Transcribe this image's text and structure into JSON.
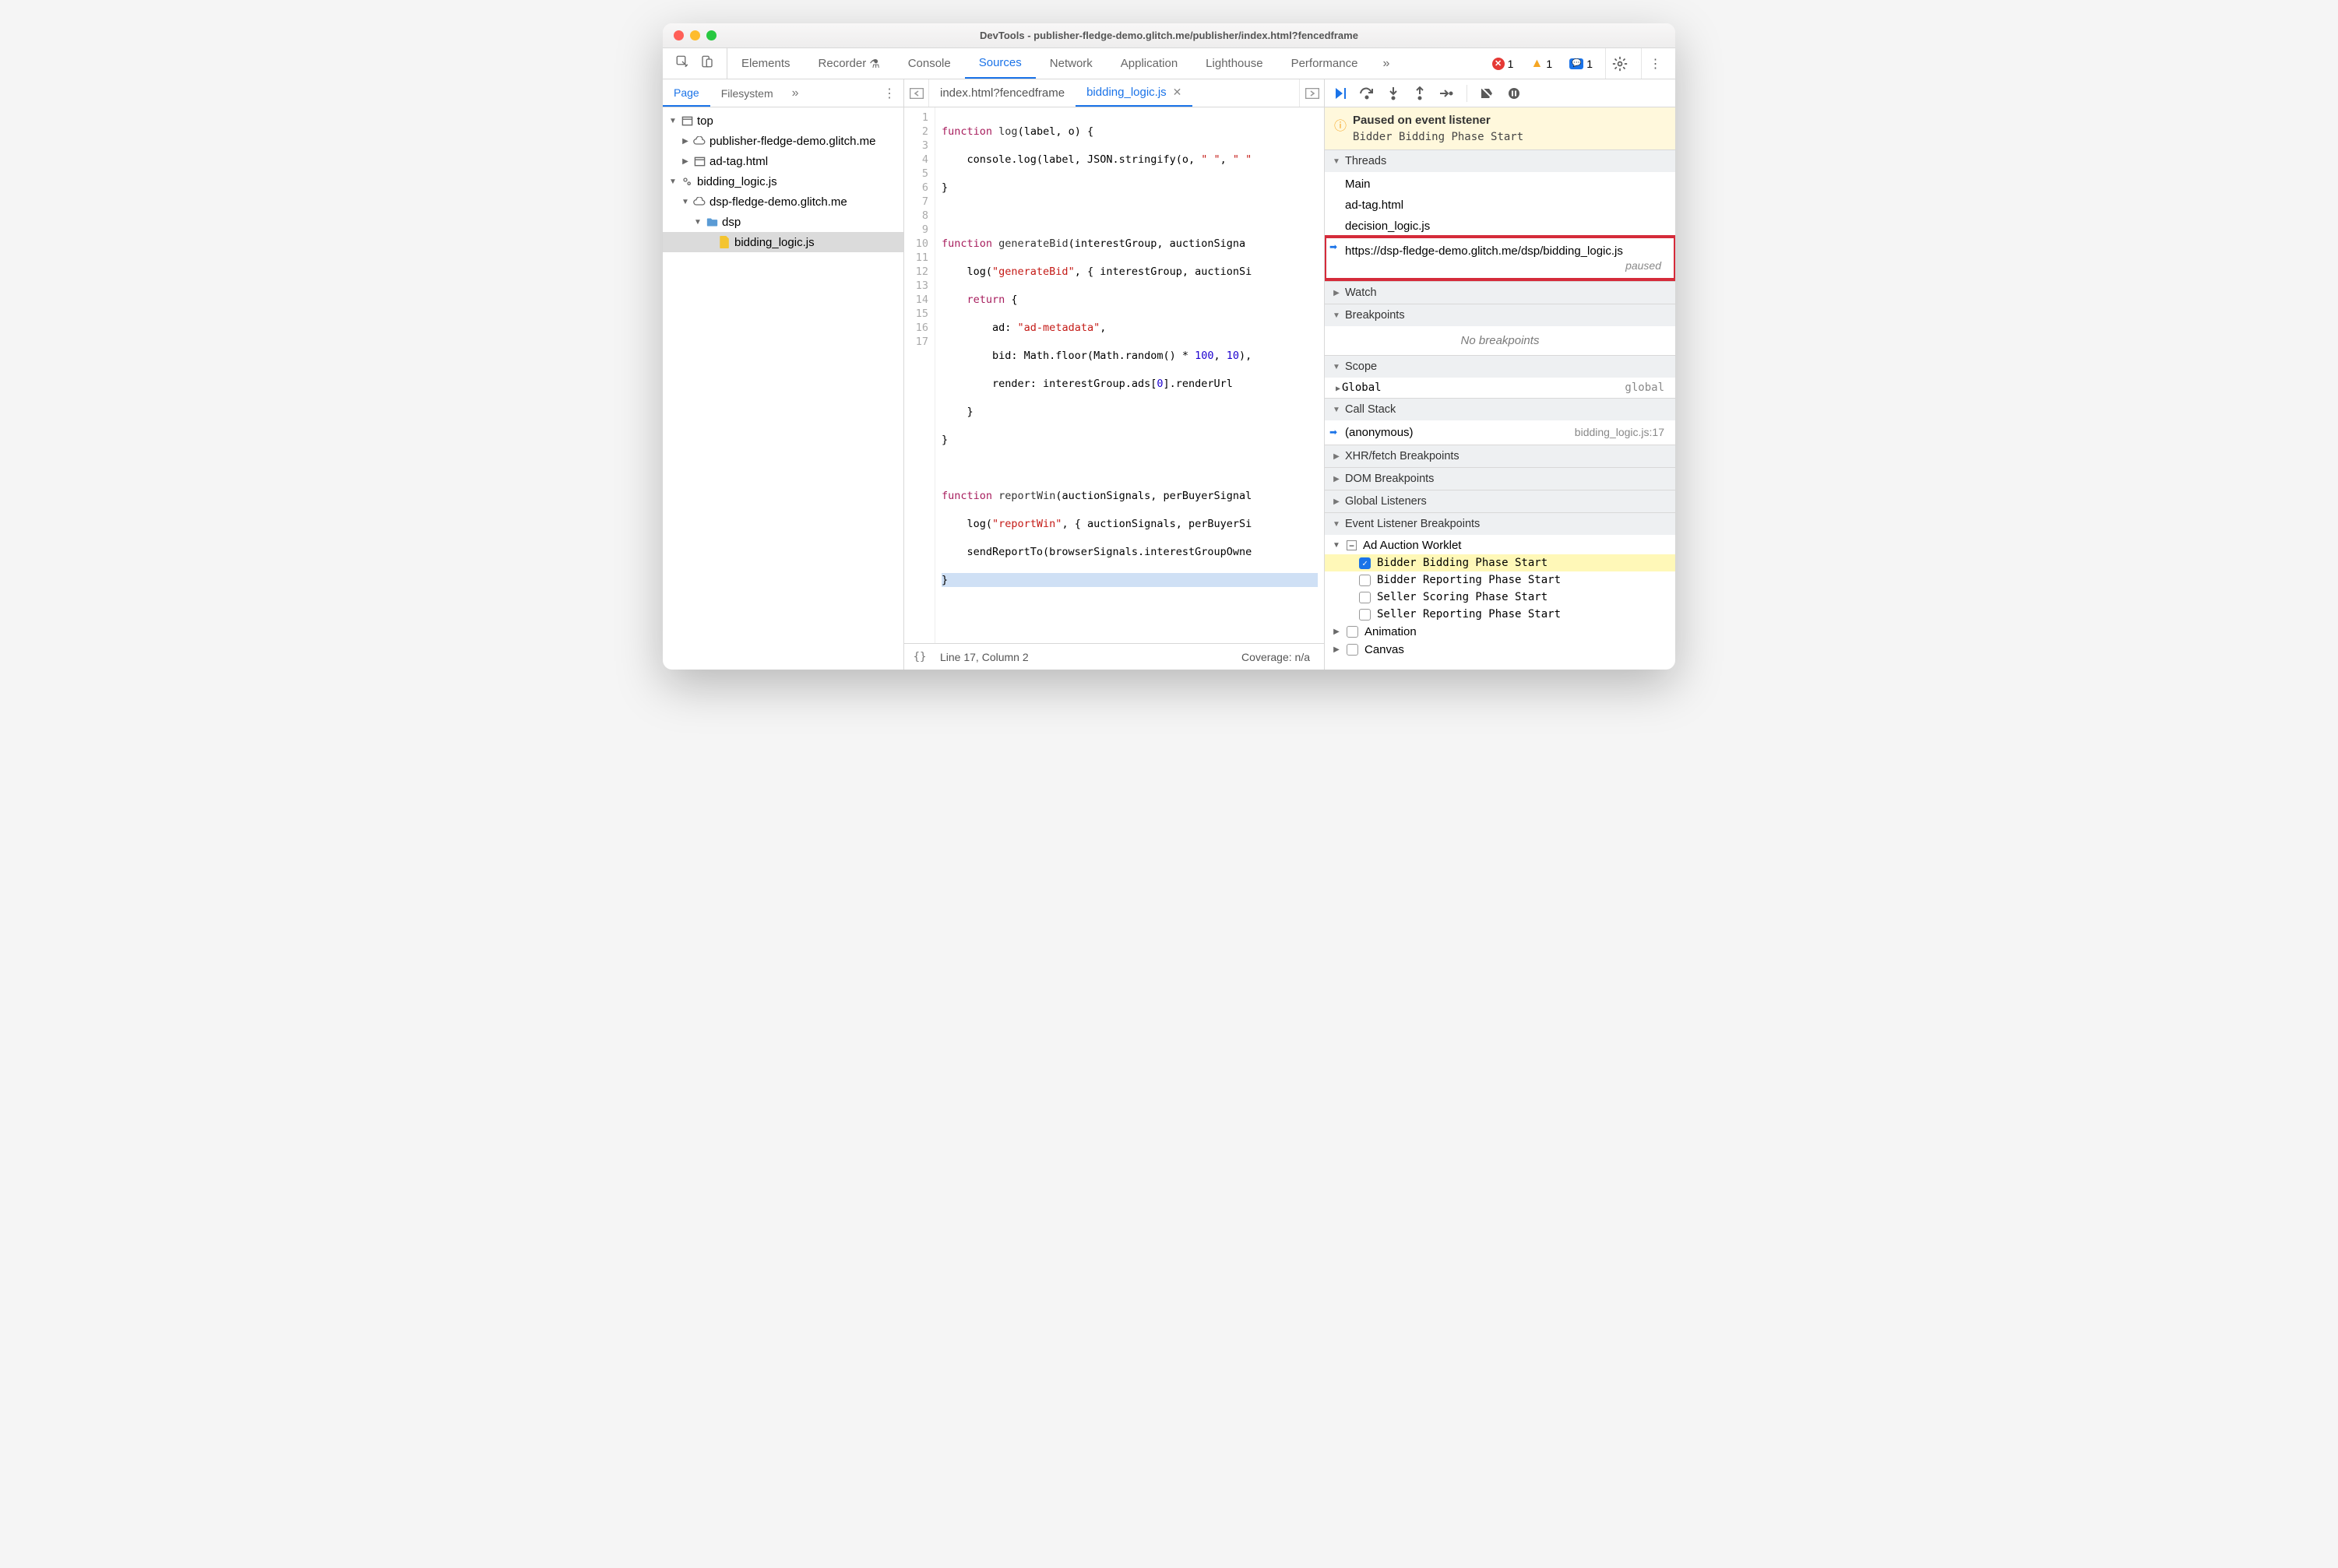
{
  "window": {
    "title": "DevTools - publisher-fledge-demo.glitch.me/publisher/index.html?fencedframe"
  },
  "toolbar": {
    "tabs": [
      "Elements",
      "Recorder",
      "Console",
      "Sources",
      "Network",
      "Application",
      "Lighthouse",
      "Performance"
    ],
    "active": "Sources",
    "errors": "1",
    "warnings": "1",
    "info": "1"
  },
  "left": {
    "tabs": [
      "Page",
      "Filesystem"
    ],
    "active": "Page",
    "tree": {
      "top": "top",
      "pub": "publisher-fledge-demo.glitch.me",
      "adtag": "ad-tag.html",
      "bidroot": "bidding_logic.js",
      "dsp": "dsp-fledge-demo.glitch.me",
      "dspfolder": "dsp",
      "bidfile": "bidding_logic.js"
    }
  },
  "center": {
    "tabs": [
      {
        "label": "index.html?fencedframe",
        "active": false
      },
      {
        "label": "bidding_logic.js",
        "active": true
      }
    ],
    "lines": 17,
    "footer": {
      "pos": "Line 17, Column 2",
      "coverage": "Coverage: n/a"
    }
  },
  "right": {
    "paused": {
      "title": "Paused on event listener",
      "sub": "Bidder Bidding Phase Start"
    },
    "threads": {
      "title": "Threads",
      "items": [
        {
          "label": "Main"
        },
        {
          "label": "ad-tag.html"
        },
        {
          "label": "decision_logic.js"
        },
        {
          "label": "https://dsp-fledge-demo.glitch.me/dsp/bidding_logic.js",
          "current": true,
          "status": "paused"
        }
      ]
    },
    "watch": "Watch",
    "breakpoints": {
      "title": "Breakpoints",
      "empty": "No breakpoints"
    },
    "scope": {
      "title": "Scope",
      "global_l": "Global",
      "global_r": "global"
    },
    "callstack": {
      "title": "Call Stack",
      "item_l": "(anonymous)",
      "item_r": "bidding_logic.js:17"
    },
    "xhr": "XHR/fetch Breakpoints",
    "dom": "DOM Breakpoints",
    "global": "Global Listeners",
    "elb": {
      "title": "Event Listener Breakpoints",
      "group": "Ad Auction Worklet",
      "items": [
        {
          "label": "Bidder Bidding Phase Start",
          "checked": true
        },
        {
          "label": "Bidder Reporting Phase Start",
          "checked": false
        },
        {
          "label": "Seller Scoring Phase Start",
          "checked": false
        },
        {
          "label": "Seller Reporting Phase Start",
          "checked": false
        }
      ],
      "anim": "Animation",
      "canvas": "Canvas"
    }
  }
}
